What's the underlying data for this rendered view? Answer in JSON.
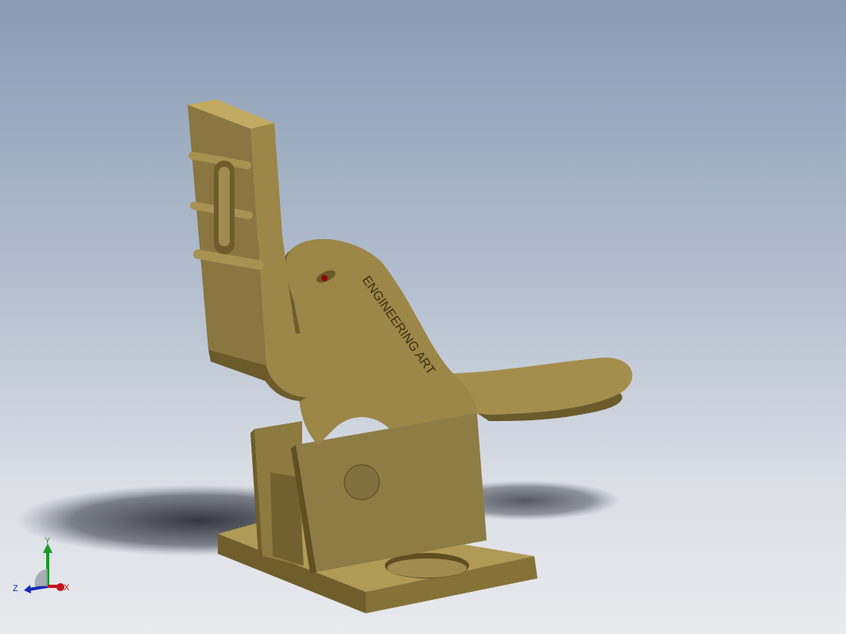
{
  "viewport": {
    "background_top": "#8a9bb3",
    "background_bottom": "#e9eaee"
  },
  "model": {
    "part_color": "#9c8648",
    "part_shadow_color": "#6b5a2a",
    "eye_color": "#8b0a0a",
    "engraved_text": "ENGINEERING ART"
  },
  "triad": {
    "x_label": "X",
    "y_label": "Y",
    "z_label": "Z",
    "x_color": "#c0141e",
    "y_color": "#1a9a2a",
    "z_color": "#1a2ab8"
  }
}
